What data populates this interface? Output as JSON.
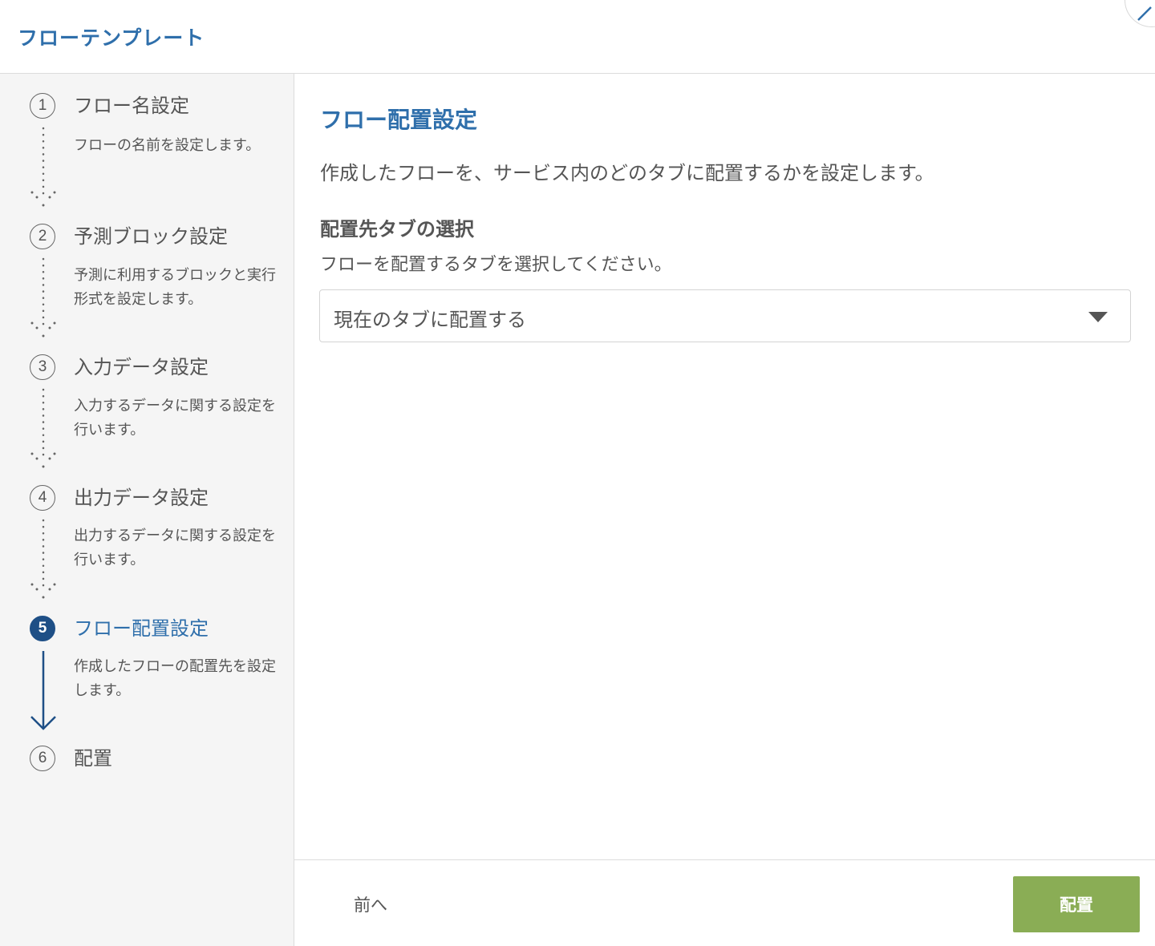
{
  "header": {
    "title": "フローテンプレート"
  },
  "steps": [
    {
      "num": "1",
      "title": "フロー名設定",
      "desc": "フローの名前を設定します。",
      "active": false
    },
    {
      "num": "2",
      "title": "予測ブロック設定",
      "desc": "予測に利用するブロックと実行形式を設定します。",
      "active": false
    },
    {
      "num": "3",
      "title": "入力データ設定",
      "desc": "入力するデータに関する設定を行います。",
      "active": false
    },
    {
      "num": "4",
      "title": "出力データ設定",
      "desc": "出力するデータに関する設定を行います。",
      "active": false
    },
    {
      "num": "5",
      "title": "フロー配置設定",
      "desc": "作成したフローの配置先を設定します。",
      "active": true
    },
    {
      "num": "6",
      "title": "配置",
      "desc": "",
      "active": false
    }
  ],
  "main": {
    "title": "フロー配置設定",
    "description": "作成したフローを、サービス内のどのタブに配置するかを設定します。",
    "section_title": "配置先タブの選択",
    "section_description": "フローを配置するタブを選択してください。",
    "select_value": "現在のタブに配置する"
  },
  "footer": {
    "prev_label": "前へ",
    "deploy_label": "配置"
  },
  "colors": {
    "accent": "#2f6fab",
    "active_step": "#1e4f86",
    "deploy_button": "#8aad55"
  },
  "icons": {
    "close": "close-icon",
    "dropdown": "caret-down-icon"
  }
}
